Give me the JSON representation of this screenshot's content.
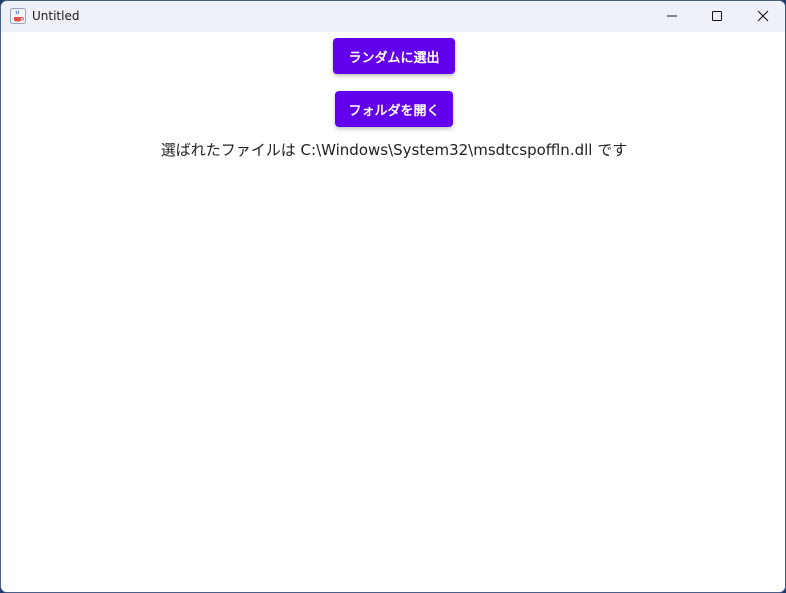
{
  "window": {
    "title": "Untitled",
    "app_icon": "java-coffee-icon",
    "controls": [
      "minimize-icon",
      "maximize-icon",
      "close-icon"
    ]
  },
  "main": {
    "random_button_label": "ランダムに選出",
    "open_folder_button_label": "フォルダを開く",
    "result_text": "選ばれたファイルは C:\\Windows\\System32\\msdtcspoffln.dll です"
  },
  "colors": {
    "button_bg": "#6200ee",
    "button_text": "#ffffff",
    "titlebar_bg": "#eef1f7"
  }
}
